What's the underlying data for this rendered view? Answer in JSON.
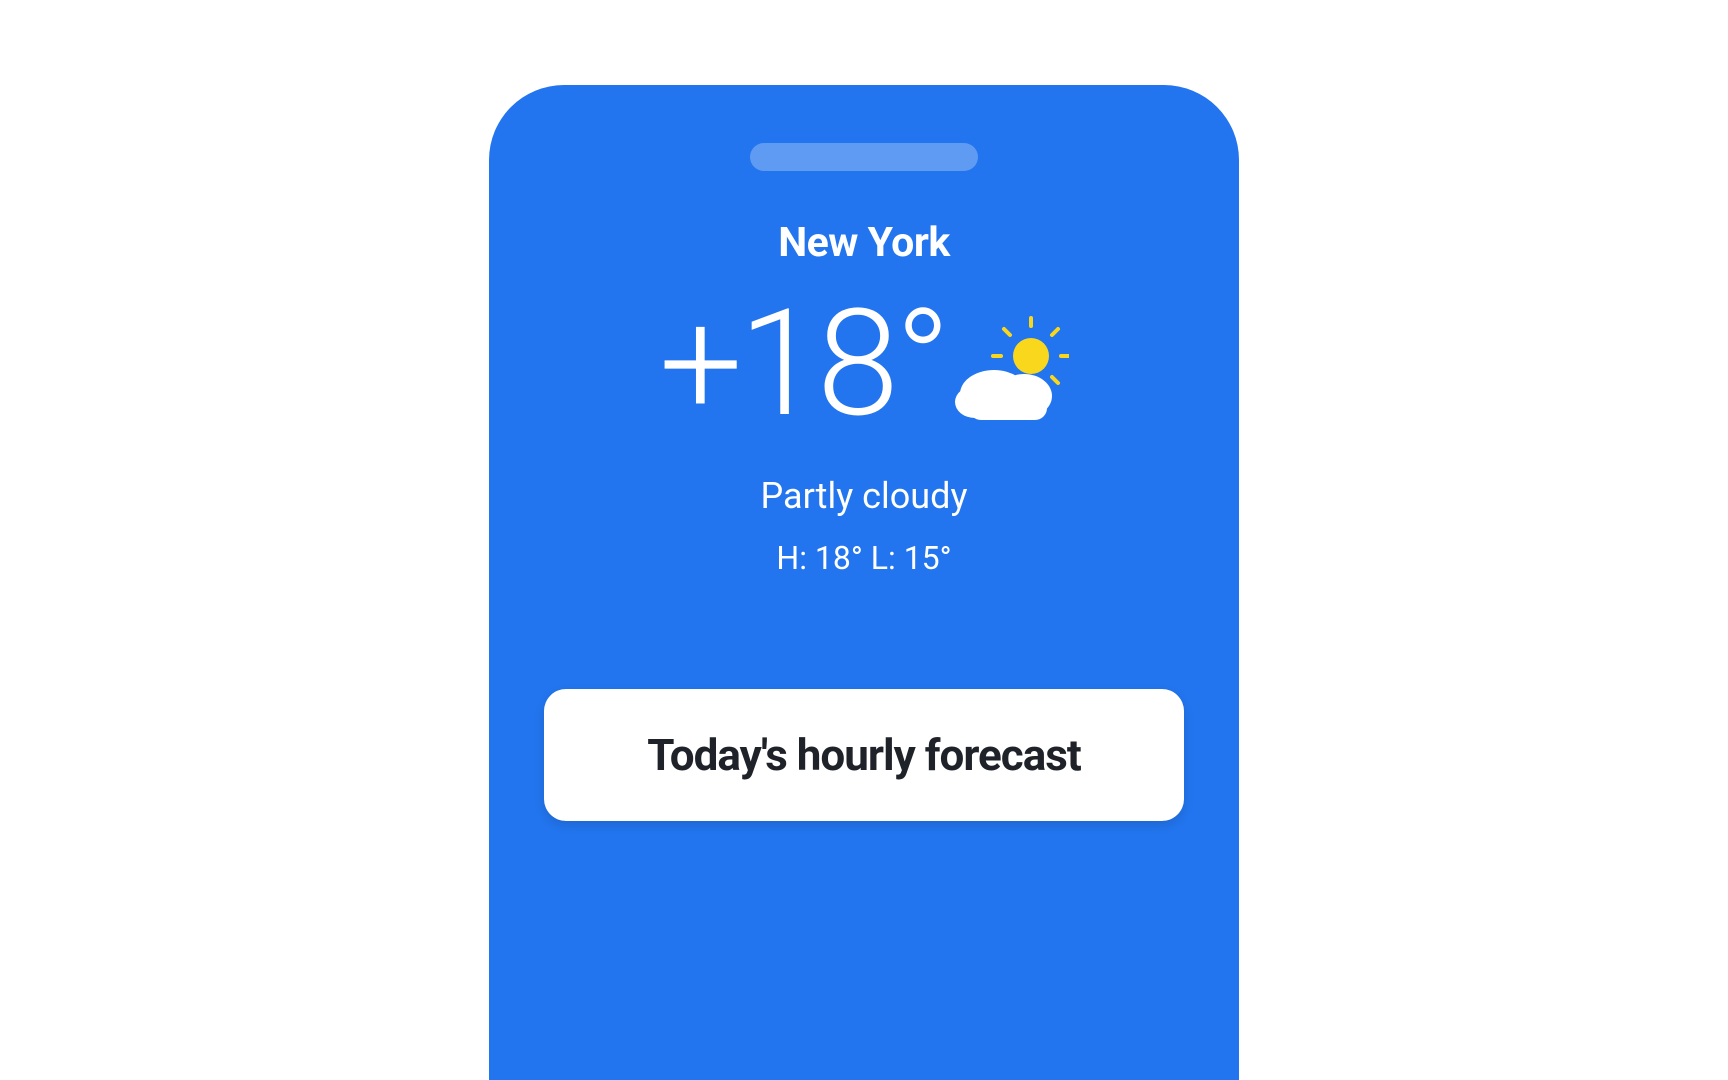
{
  "weather": {
    "city": "New York",
    "temperature": "+18°",
    "condition": "Partly cloudy",
    "high_low": "H: 18° L: 15°"
  },
  "forecast": {
    "title": "Today's hourly forecast"
  }
}
